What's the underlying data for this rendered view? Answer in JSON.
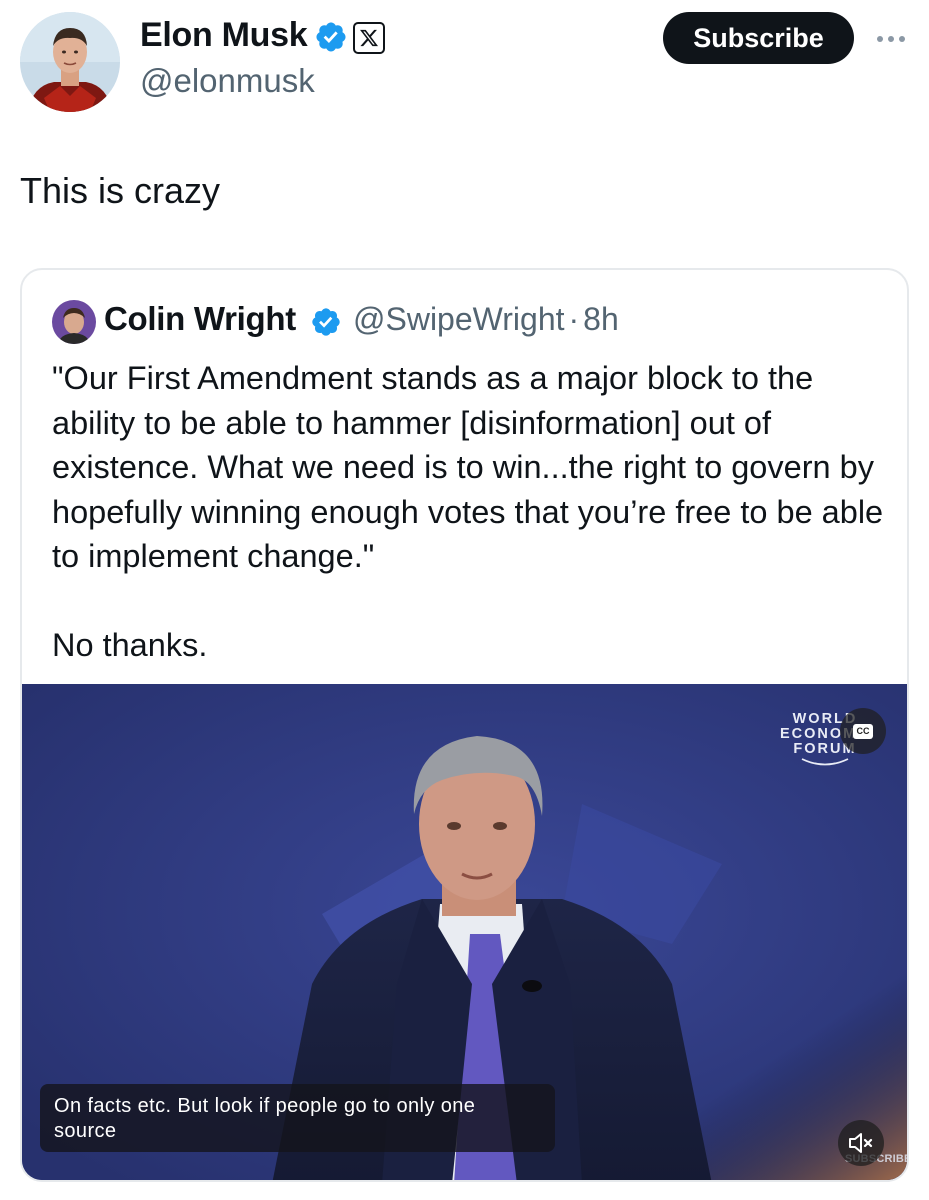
{
  "tweet": {
    "author_name": "Elon Musk",
    "author_handle": "@elonmusk",
    "subscribe_label": "Subscribe",
    "text": "This is crazy"
  },
  "quoted_tweet": {
    "author_name": "Colin Wright",
    "author_handle": "@SwipeWright",
    "separator": "·",
    "time": "8h",
    "paragraphs": [
      "\"Our First Amendment stands as a major block to the ability to be able to hammer [disinformation] out of existence. What we need is to win...the right to govern by hopefully winning enough votes that you’re free to be able to implement change.\"",
      "No thanks."
    ]
  },
  "video": {
    "logo_lines": [
      "WORLD",
      "ECONOMIC",
      "FORUM"
    ],
    "cc_label": "CC",
    "caption_lines": [
      "On facts etc. But look if people go to only one",
      "source"
    ],
    "watermark": "SUBSCRIBE"
  },
  "icons": {
    "verified": "verified-badge-icon",
    "x_logo": "x-logo-icon",
    "more": "more-options-icon",
    "cc": "closed-captions-icon",
    "mute": "muted-speaker-icon"
  },
  "colors": {
    "verified_blue": "#1d9bf0",
    "button_black": "#0f1419",
    "handle_gray": "#536471",
    "video_background": "#2e3a80"
  }
}
